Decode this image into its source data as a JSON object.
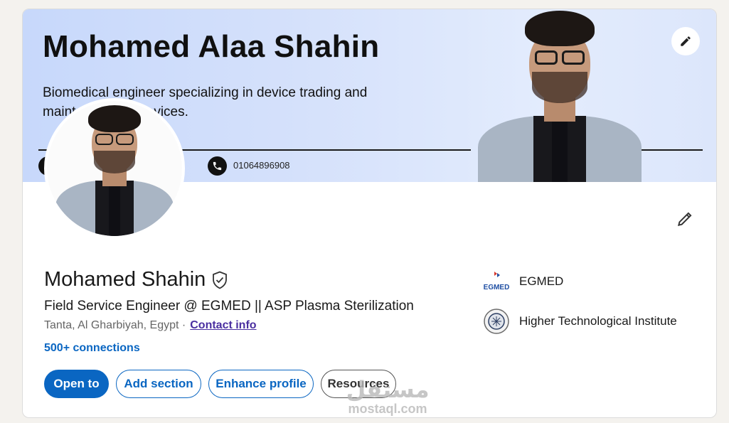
{
  "banner": {
    "name": "Mohamed Alaa Shahin",
    "tagline": "Biomedical engineer  specializing in device trading and maintenance of devices.",
    "phone": "01064896908",
    "phone_icon": "phone-icon",
    "edit_icon": "pencil-icon"
  },
  "profile": {
    "name": "Mohamed Shahin",
    "verified_icon": "verified-shield-icon",
    "headline": "Field Service Engineer @ EGMED || ASP Plasma Sterilization",
    "location": "Tanta, Al Gharbiyah, Egypt",
    "separator": " ·",
    "contact_info": "Contact info",
    "connections": "500+ connections",
    "edit_icon": "pencil-icon"
  },
  "actions": {
    "open_to": "Open to",
    "add_section": "Add section",
    "enhance_profile": "Enhance profile",
    "resources": "Resources"
  },
  "organizations": [
    {
      "name": "EGMED",
      "logo_text": "EGMED",
      "logo": "egmed-logo"
    },
    {
      "name": "Higher Technological Institute",
      "logo": "hti-seal-logo"
    }
  ],
  "watermark": {
    "arabic": "مستقل",
    "english": "mostaql.com"
  },
  "colors": {
    "primary": "#0a66c2",
    "contact_link": "#4a2fa0",
    "banner_gradient_start": "#c7d8fb",
    "banner_gradient_end": "#dce6fb"
  }
}
